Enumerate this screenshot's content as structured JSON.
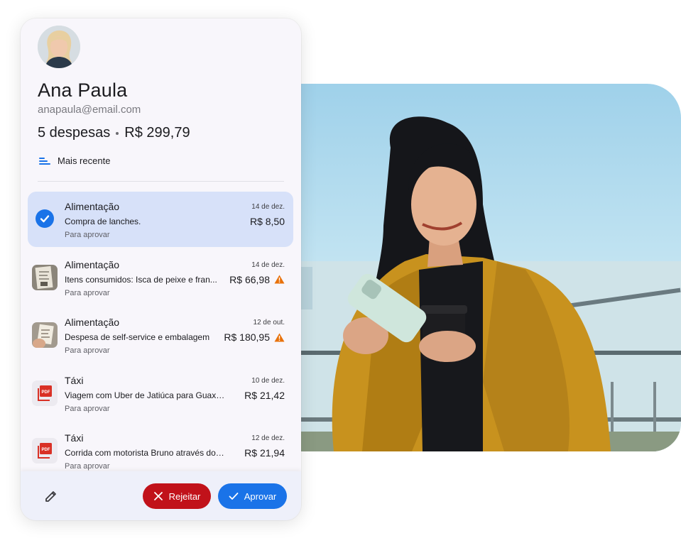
{
  "user": {
    "name": "Ana Paula",
    "email": "anapaula@email.com"
  },
  "summary": {
    "count": "5 despesas",
    "total": "R$ 299,79"
  },
  "sort": {
    "label": "Mais recente"
  },
  "expenses": [
    {
      "category": "Alimentação",
      "date": "14 de dez.",
      "description": "Compra de lanches.",
      "amount": "R$ 8,50",
      "status": "Para aprovar",
      "thumb": "check-icon",
      "warning": false,
      "selected": true
    },
    {
      "category": "Alimentação",
      "date": "14 de dez.",
      "description": "Itens consumidos: Isca de peixe e fran...",
      "amount": "R$ 66,98",
      "status": "Para aprovar",
      "thumb": "receipt-photo",
      "warning": true,
      "selected": false
    },
    {
      "category": "Alimentação",
      "date": "12 de out.",
      "description": "Despesa de self-service e embalagem",
      "amount": "R$ 180,95",
      "status": "Para aprovar",
      "thumb": "receipt-photo",
      "warning": true,
      "selected": false
    },
    {
      "category": "Táxi",
      "date": "10 de dez.",
      "description": "Viagem com Uber de Jatiúca para Guaxum...",
      "amount": "R$ 21,42",
      "status": "Para aprovar",
      "thumb": "pdf-icon",
      "warning": false,
      "selected": false
    },
    {
      "category": "Táxi",
      "date": "12 de dez.",
      "description": "Corrida com motorista Bruno através do a...",
      "amount": "R$ 21,94",
      "status": "Para aprovar",
      "thumb": "pdf-icon",
      "warning": false,
      "selected": false
    }
  ],
  "actions": {
    "reject_label": "Rejeitar",
    "approve_label": "Aprovar"
  },
  "pdf_badge": "PDF",
  "colors": {
    "accent": "#1a73e8",
    "reject": "#c1121a",
    "warning": "#e8710a",
    "selected_row": "#d7e1f9"
  }
}
